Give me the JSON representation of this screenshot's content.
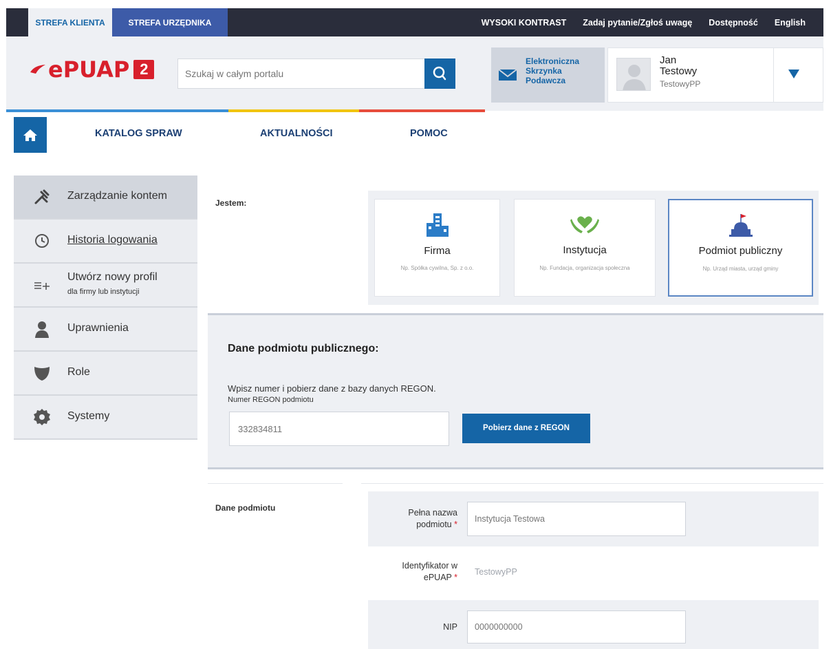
{
  "topbar": {
    "tab_client": "STREFA KLIENTA",
    "tab_official": "STREFA URZĘDNIKA",
    "high_contrast": "WYSOKI KONTRAST",
    "ask_question": "Zadaj pytanie/Zgłoś uwagę",
    "accessibility": "Dostępność",
    "language": "English"
  },
  "header": {
    "logo_text": "ePUAP",
    "logo_version": "2",
    "search_placeholder": "Szukaj w całym portalu",
    "mailbox_label_1": "Elektroniczna",
    "mailbox_label_2": "Skrzynka",
    "mailbox_label_3": "Podawcza",
    "user_first_name": "Jan",
    "user_last_name": "Testowy",
    "user_login": "TestowyPP"
  },
  "nav": {
    "items": [
      "KATALOG SPRAW",
      "AKTUALNOŚCI",
      "POMOC"
    ]
  },
  "sidebar": {
    "items": [
      {
        "label": "Zarządzanie kontem",
        "icon": "tools-icon"
      },
      {
        "label": "Historia logowania",
        "icon": "clock-icon"
      },
      {
        "label": "Utwórz nowy profil",
        "sub": "dla firmy lub instytucji",
        "icon": "add-list-icon"
      },
      {
        "label": "Uprawnienia",
        "icon": "person-icon"
      },
      {
        "label": "Role",
        "icon": "mask-icon"
      },
      {
        "label": "Systemy",
        "icon": "gear-icon"
      }
    ]
  },
  "entity_type": {
    "label": "Jestem:",
    "options": [
      {
        "name": "Firma",
        "desc": "Np. Spółka cywilna, Sp. z o.o.",
        "icon": "buildings-icon"
      },
      {
        "name": "Instytucja",
        "desc": "Np. Fundacja, organizacja społeczna",
        "icon": "hands-heart-icon"
      },
      {
        "name": "Podmiot publiczny",
        "desc": "Np. Urząd miasta, urząd gminy",
        "icon": "public-building-icon"
      }
    ],
    "selected": "Podmiot publiczny"
  },
  "regon": {
    "title": "Dane podmiotu publicznego:",
    "info": "Wpisz numer i pobierz dane z bazy danych REGON.",
    "field_label": "Numer REGON podmiotu",
    "field_value": "332834811",
    "button_label": "Pobierz dane z REGON"
  },
  "entity_data": {
    "section_label": "Dane podmiotu",
    "full_name_label_1": "Pełna nazwa",
    "full_name_label_2": "podmiotu",
    "full_name_value": "Instytucja Testowa",
    "id_label_1": "Identyfikator w",
    "id_label_2": "ePUAP",
    "id_value": "TestowyPP",
    "nip_label": "NIP",
    "nip_value": "0000000000",
    "required_mark": "*"
  },
  "colors": {
    "primary": "#1565a6",
    "brand_red": "#d8202c",
    "topbar_bg": "#2a2d3b",
    "accent_blue": "#3d5ba8",
    "bar_blue": "#3a8fd6",
    "bar_yellow": "#f1c40f",
    "bar_red": "#e74c3c"
  }
}
